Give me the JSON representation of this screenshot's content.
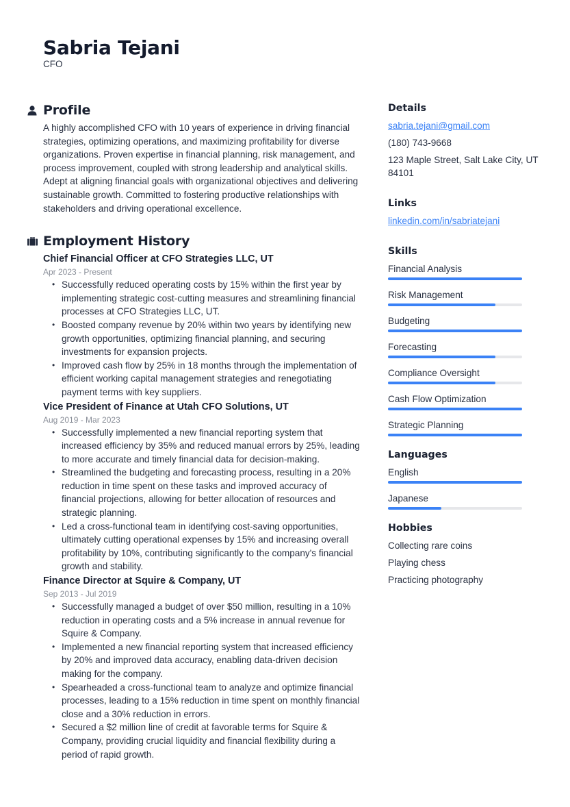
{
  "header": {
    "name": "Sabria Tejani",
    "role": "CFO"
  },
  "profile": {
    "title": "Profile",
    "icon": "person-icon",
    "text": "A highly accomplished CFO with 10 years of experience in driving financial strategies, optimizing operations, and maximizing profitability for diverse organizations. Proven expertise in financial planning, risk management, and process improvement, coupled with strong leadership and analytical skills. Adept at aligning financial goals with organizational objectives and delivering sustainable growth. Committed to fostering productive relationships with stakeholders and driving operational excellence."
  },
  "employment": {
    "title": "Employment History",
    "icon": "briefcase-icon",
    "jobs": [
      {
        "title": "Chief Financial Officer at CFO Strategies LLC, UT",
        "dates": "Apr 2023 - Present",
        "bullets": [
          "Successfully reduced operating costs by 15% within the first year by implementing strategic cost-cutting measures and streamlining financial processes at CFO Strategies LLC, UT.",
          "Boosted company revenue by 20% within two years by identifying new growth opportunities, optimizing financial planning, and securing investments for expansion projects.",
          "Improved cash flow by 25% in 18 months through the implementation of efficient working capital management strategies and renegotiating payment terms with key suppliers."
        ]
      },
      {
        "title": "Vice President of Finance at Utah CFO Solutions, UT",
        "dates": "Aug 2019 - Mar 2023",
        "bullets": [
          "Successfully implemented a new financial reporting system that increased efficiency by 35% and reduced manual errors by 25%, leading to more accurate and timely financial data for decision-making.",
          "Streamlined the budgeting and forecasting process, resulting in a 20% reduction in time spent on these tasks and improved accuracy of financial projections, allowing for better allocation of resources and strategic planning.",
          "Led a cross-functional team in identifying cost-saving opportunities, ultimately cutting operational expenses by 15% and increasing overall profitability by 10%, contributing significantly to the company's financial growth and stability."
        ]
      },
      {
        "title": "Finance Director at Squire & Company, UT",
        "dates": "Sep 2013 - Jul 2019",
        "bullets": [
          "Successfully managed a budget of over $50 million, resulting in a 10% reduction in operating costs and a 5% increase in annual revenue for Squire & Company.",
          "Implemented a new financial reporting system that increased efficiency by 20% and improved data accuracy, enabling data-driven decision making for the company.",
          "Spearheaded a cross-functional team to analyze and optimize financial processes, leading to a 15% reduction in time spent on monthly financial close and a 30% reduction in errors.",
          "Secured a $2 million line of credit at favorable terms for Squire & Company, providing crucial liquidity and financial flexibility during a period of rapid growth."
        ]
      }
    ]
  },
  "details": {
    "title": "Details",
    "email": "sabria.tejani@gmail.com",
    "phone": "(180) 743-9668",
    "address": "123 Maple Street, Salt Lake City, UT 84101"
  },
  "links": {
    "title": "Links",
    "items": [
      "linkedin.com/in/sabriatejani"
    ]
  },
  "skills": {
    "title": "Skills",
    "items": [
      {
        "label": "Financial Analysis",
        "level": 1.0
      },
      {
        "label": "Risk Management",
        "level": 0.8
      },
      {
        "label": "Budgeting",
        "level": 1.0
      },
      {
        "label": "Forecasting",
        "level": 0.8
      },
      {
        "label": "Compliance Oversight",
        "level": 0.8
      },
      {
        "label": "Cash Flow Optimization",
        "level": 1.0
      },
      {
        "label": "Strategic Planning",
        "level": 1.0
      }
    ]
  },
  "languages": {
    "title": "Languages",
    "items": [
      {
        "label": "English",
        "level": 1.0
      },
      {
        "label": "Japanese",
        "level": 0.4
      }
    ]
  },
  "hobbies": {
    "title": "Hobbies",
    "items": [
      "Collecting rare coins",
      "Playing chess",
      "Practicing photography"
    ]
  },
  "colors": {
    "accent": "#3b82f6",
    "bar_track": "#e6e7ea",
    "heading": "#1b2232",
    "muted": "#8a8f99"
  }
}
